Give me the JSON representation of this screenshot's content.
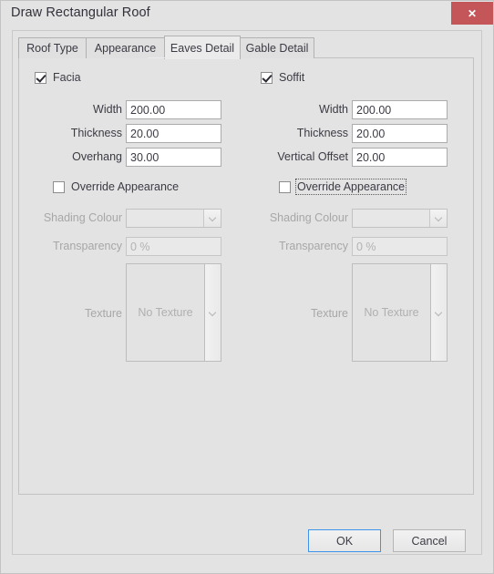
{
  "window": {
    "title": "Draw Rectangular Roof",
    "close_label": "✕",
    "close_color": "#c4565a"
  },
  "tabs": [
    {
      "label": "Roof Type",
      "active": false
    },
    {
      "label": "Appearance",
      "active": false
    },
    {
      "label": "Eaves Detail",
      "active": true
    },
    {
      "label": "Gable Detail",
      "active": false
    }
  ],
  "panels": {
    "facia": {
      "enable_label": "Facia",
      "enabled": true,
      "fields": [
        {
          "label": "Width",
          "value": "200.00"
        },
        {
          "label": "Thickness",
          "value": "20.00"
        },
        {
          "label": "Overhang",
          "value": "30.00"
        }
      ],
      "override": {
        "label": "Override Appearance",
        "checked": false,
        "focused": false
      },
      "shading_colour": {
        "label": "Shading Colour",
        "value": ""
      },
      "transparency": {
        "label": "Transparency",
        "value": "0 %"
      },
      "texture": {
        "label": "Texture",
        "value": "No Texture"
      }
    },
    "soffit": {
      "enable_label": "Soffit",
      "enabled": true,
      "fields": [
        {
          "label": "Width",
          "value": "200.00"
        },
        {
          "label": "Thickness",
          "value": "20.00"
        },
        {
          "label": "Vertical Offset",
          "value": "20.00"
        }
      ],
      "override": {
        "label": "Override Appearance",
        "checked": false,
        "focused": true
      },
      "shading_colour": {
        "label": "Shading Colour",
        "value": ""
      },
      "transparency": {
        "label": "Transparency",
        "value": "0 %"
      },
      "texture": {
        "label": "Texture",
        "value": "No Texture"
      }
    }
  },
  "footer": {
    "ok_label": "OK",
    "cancel_label": "Cancel",
    "default_button_color": "#3d94e8"
  }
}
